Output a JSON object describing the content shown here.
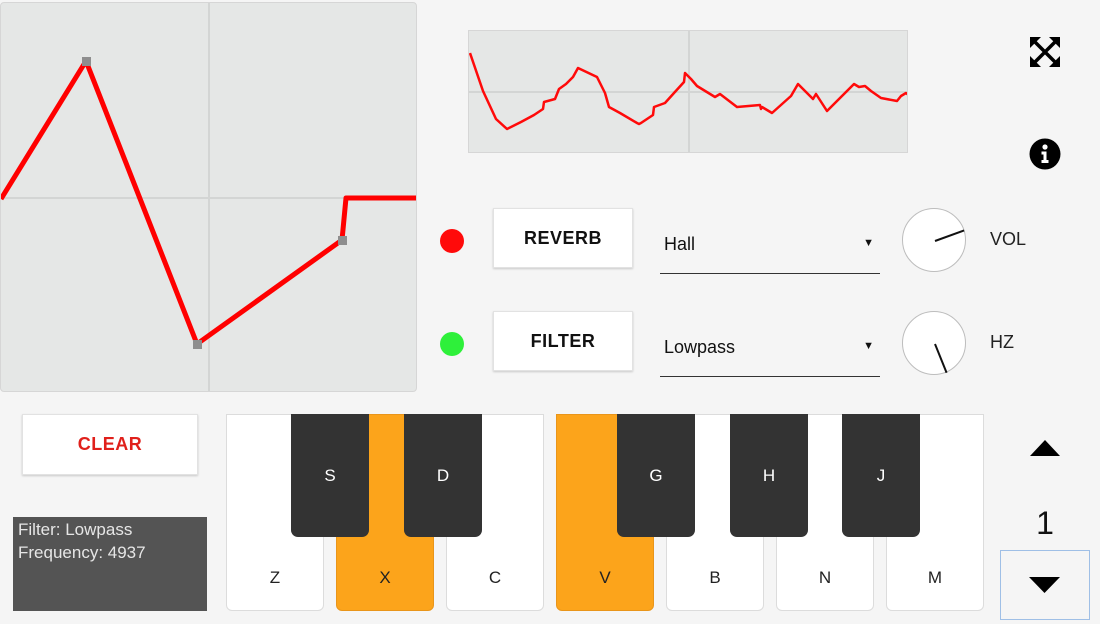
{
  "effects": [
    {
      "name": "reverb",
      "label": "REVERB",
      "led_color": "#ff0a0a",
      "select_value": "Hall",
      "knob_label": "VOL",
      "knob_value_deg": 70
    },
    {
      "name": "filter",
      "label": "FILTER",
      "led_color": "#2ef03a",
      "select_value": "Lowpass",
      "knob_label": "HZ",
      "knob_value_deg": 158
    }
  ],
  "clear_label": "CLEAR",
  "status": {
    "filter_line": "Filter: Lowpass",
    "frequency_line": "Frequency: 4937"
  },
  "white_keys": [
    {
      "label": "Z",
      "active": false
    },
    {
      "label": "X",
      "active": true
    },
    {
      "label": "C",
      "active": false
    },
    {
      "label": "V",
      "active": true
    },
    {
      "label": "B",
      "active": false
    },
    {
      "label": "N",
      "active": false
    },
    {
      "label": "M",
      "active": false
    }
  ],
  "black_keys": [
    "S",
    "D",
    "G",
    "H",
    "J"
  ],
  "octave": "1",
  "icons": {
    "fullscreen": "fullscreen-icon",
    "info": "info-icon",
    "octave_up": "triangle-up-icon",
    "octave_down": "triangle-down-icon"
  },
  "colors": {
    "waveform": "#ff0000",
    "active_key": "#fca41b",
    "clear_text": "#e0201b"
  }
}
